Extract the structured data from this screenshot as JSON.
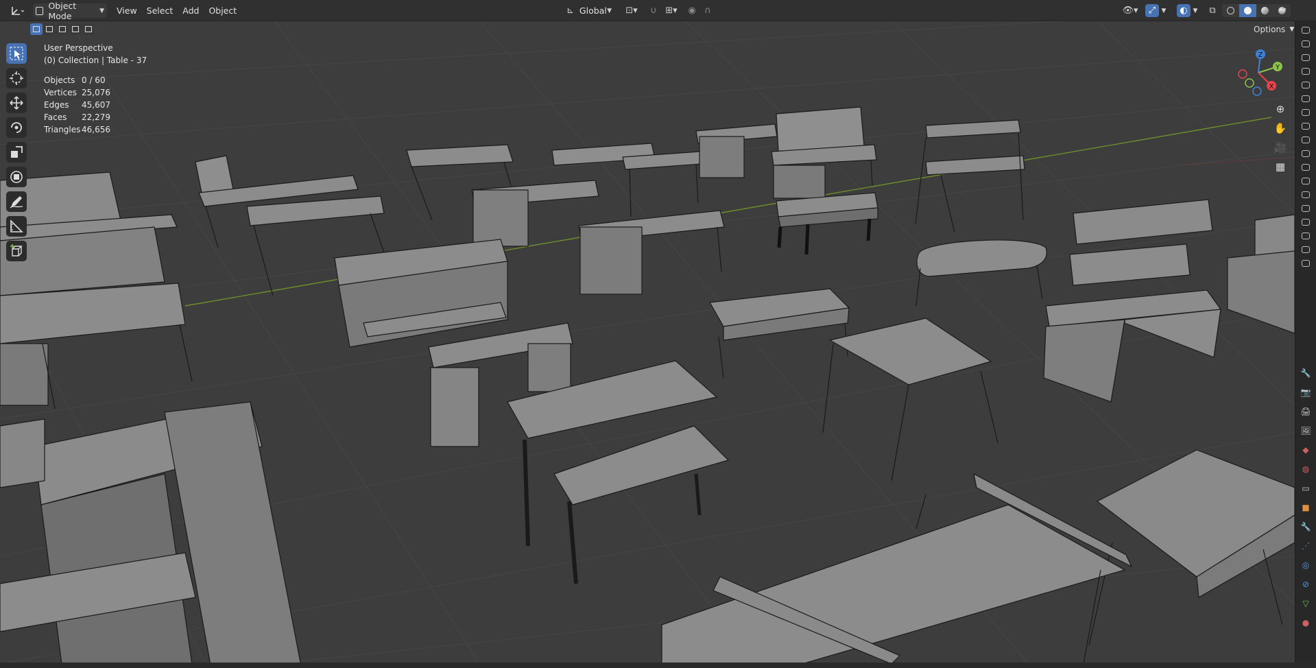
{
  "header": {
    "mode": "Object Mode",
    "menus": [
      "View",
      "Select",
      "Add",
      "Object"
    ],
    "orientation": "Global",
    "options_label": "Options"
  },
  "overlay": {
    "view_name": "User Perspective",
    "collection": "(0) Collection | Table - 37",
    "stats": [
      {
        "label": "Objects",
        "value": "0 / 60"
      },
      {
        "label": "Vertices",
        "value": "25,076"
      },
      {
        "label": "Edges",
        "value": "45,607"
      },
      {
        "label": "Faces",
        "value": "22,279"
      },
      {
        "label": "Triangles",
        "value": "46,656"
      }
    ]
  },
  "gizmo": {
    "x": "X",
    "y": "Y",
    "z": "Z"
  },
  "colors": {
    "accent": "#4772b3",
    "x_axis": "#e8434c",
    "y_axis": "#8bc34a",
    "z_axis": "#3f82d9",
    "x_line": "#7a3a3a",
    "y_line": "#7a9a2e"
  },
  "tools": [
    "select-box",
    "cursor",
    "move",
    "rotate",
    "scale",
    "transform",
    "annotate",
    "measure",
    "add-cube"
  ]
}
